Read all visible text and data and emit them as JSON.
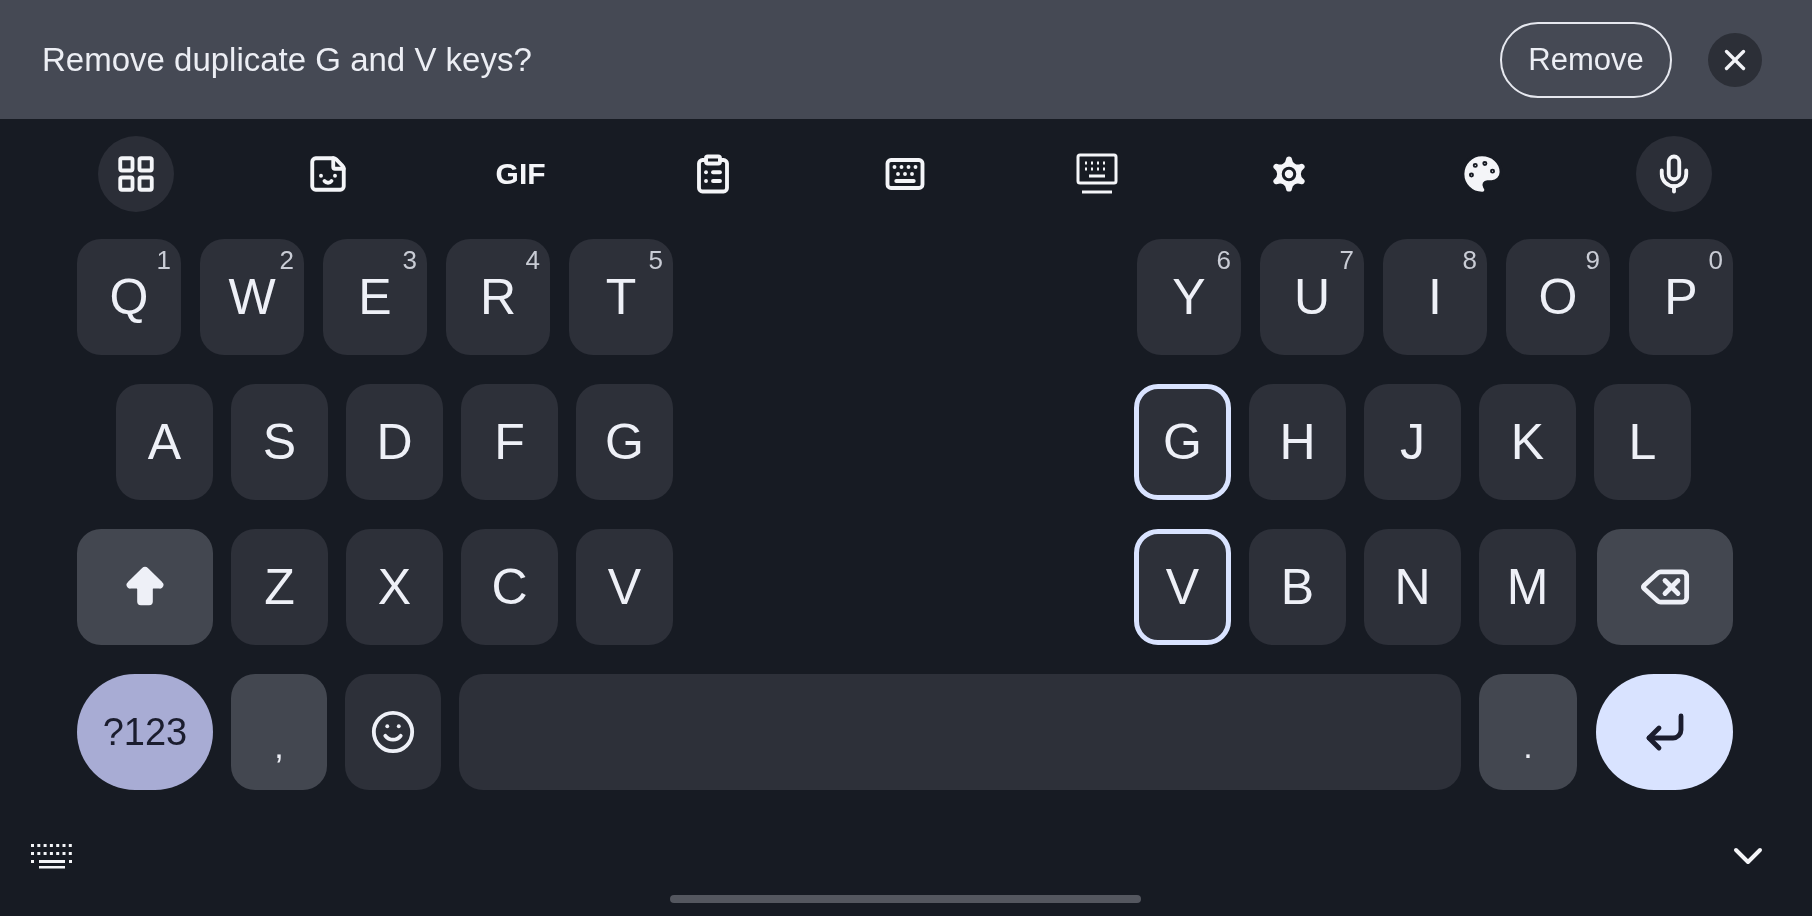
{
  "banner": {
    "message": "Remove duplicate G and V keys?",
    "action_button": "Remove"
  },
  "toolbar": [
    {
      "kind": "apps",
      "highlighted": true
    },
    {
      "kind": "sticker",
      "highlighted": false
    },
    {
      "kind": "gif",
      "label": "GIF",
      "highlighted": false
    },
    {
      "kind": "clipboard",
      "highlighted": false
    },
    {
      "kind": "keyboard",
      "highlighted": false
    },
    {
      "kind": "floating-keyboard",
      "highlighted": false
    },
    {
      "kind": "settings",
      "highlighted": false
    },
    {
      "kind": "theme",
      "highlighted": false
    },
    {
      "kind": "voice",
      "highlighted": true
    }
  ],
  "rows": [
    {
      "left": [
        {
          "kind": "letter",
          "label": "Q",
          "hint": "1",
          "outlined": false
        },
        {
          "kind": "letter",
          "label": "W",
          "hint": "2",
          "outlined": false
        },
        {
          "kind": "letter",
          "label": "E",
          "hint": "3",
          "outlined": false
        },
        {
          "kind": "letter",
          "label": "R",
          "hint": "4",
          "outlined": false
        },
        {
          "kind": "letter",
          "label": "T",
          "hint": "5",
          "outlined": false
        }
      ],
      "right": [
        {
          "kind": "letter",
          "label": "Y",
          "hint": "6",
          "outlined": false
        },
        {
          "kind": "letter",
          "label": "U",
          "hint": "7",
          "outlined": false
        },
        {
          "kind": "letter",
          "label": "I",
          "hint": "8",
          "outlined": false
        },
        {
          "kind": "letter",
          "label": "O",
          "hint": "9",
          "outlined": false
        },
        {
          "kind": "letter",
          "label": "P",
          "hint": "0",
          "outlined": false
        }
      ]
    },
    {
      "left": [
        {
          "kind": "letter",
          "label": "A",
          "outlined": false
        },
        {
          "kind": "letter",
          "label": "S",
          "outlined": false
        },
        {
          "kind": "letter",
          "label": "D",
          "outlined": false
        },
        {
          "kind": "letter",
          "label": "F",
          "outlined": false
        },
        {
          "kind": "letter",
          "label": "G",
          "outlined": false
        }
      ],
      "right": [
        {
          "kind": "letter",
          "label": "G",
          "outlined": true
        },
        {
          "kind": "letter",
          "label": "H",
          "outlined": false
        },
        {
          "kind": "letter",
          "label": "J",
          "outlined": false
        },
        {
          "kind": "letter",
          "label": "K",
          "outlined": false
        },
        {
          "kind": "letter",
          "label": "L",
          "outlined": false
        }
      ]
    },
    {
      "left": [
        {
          "kind": "shift",
          "outlined": false
        },
        {
          "kind": "letter",
          "label": "Z",
          "outlined": false
        },
        {
          "kind": "letter",
          "label": "X",
          "outlined": false
        },
        {
          "kind": "letter",
          "label": "C",
          "outlined": false
        },
        {
          "kind": "letter",
          "label": "V",
          "outlined": false
        }
      ],
      "right": [
        {
          "kind": "letter",
          "label": "V",
          "outlined": true
        },
        {
          "kind": "letter",
          "label": "B",
          "outlined": false
        },
        {
          "kind": "letter",
          "label": "N",
          "outlined": false
        },
        {
          "kind": "letter",
          "label": "M",
          "outlined": false
        },
        {
          "kind": "backspace",
          "outlined": false
        }
      ]
    },
    {
      "left": [
        {
          "kind": "symbols",
          "label": "?123",
          "outlined": false
        },
        {
          "kind": "comma",
          "label": ",",
          "outlined": false
        },
        {
          "kind": "emoji",
          "outlined": false
        }
      ],
      "right": [
        {
          "kind": "space",
          "outlined": false
        },
        {
          "kind": "period",
          "label": ".",
          "outlined": false
        },
        {
          "kind": "enter",
          "outlined": false
        }
      ]
    }
  ]
}
